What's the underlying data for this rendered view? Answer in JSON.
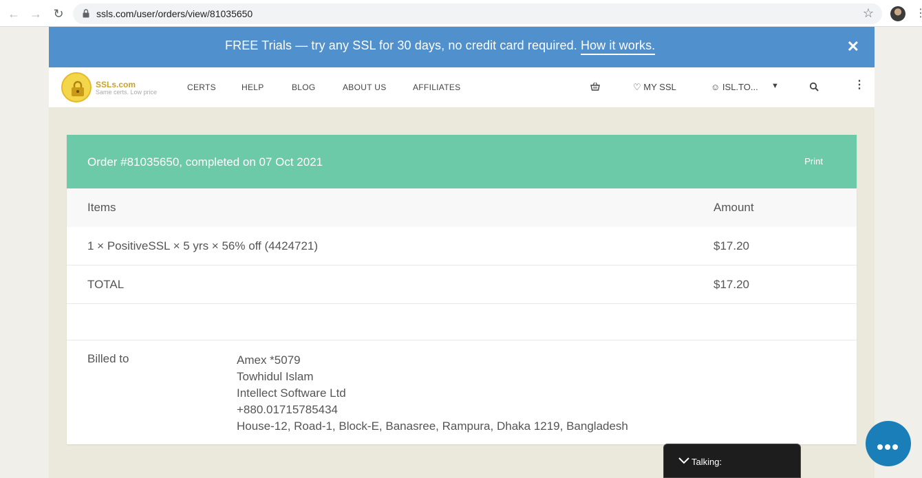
{
  "browser": {
    "url": "ssls.com/user/orders/view/81035650"
  },
  "promo": {
    "text": "FREE Trials — try any SSL for 30 days, no credit card required.",
    "link": "How it works",
    "link_suffix": "."
  },
  "header": {
    "logo_name": "SSLs.com",
    "logo_tagline": "Same certs. Low price",
    "nav": [
      "CERTS",
      "HELP",
      "BLOG",
      "ABOUT US",
      "AFFILIATES"
    ],
    "my_ssl": "MY SSL",
    "account": "ISL.TO..."
  },
  "order": {
    "title": "Order #81035650, completed on 07 Oct 2021",
    "print": "Print",
    "columns": {
      "items": "Items",
      "amount": "Amount"
    },
    "line_item": {
      "description": "1 × PositiveSSL × 5 yrs × 56% off (4424721)",
      "amount": "$17.20"
    },
    "total": {
      "label": "TOTAL",
      "amount": "$17.20"
    },
    "billed_to": {
      "label": "Billed to",
      "lines": [
        "Amex *5079",
        "Towhidul Islam",
        "Intellect Software Ltd",
        "+880.01715785434",
        "House-12, Road-1, Block-E, Banasree, Rampura, Dhaka 1219, Bangladesh"
      ]
    }
  },
  "chat": {
    "talking_label": "Talking:"
  },
  "colors": {
    "promo_bg": "#5090cc",
    "order_header_bg": "#6ccaa8",
    "chat_bubble": "#1a7fb8"
  }
}
